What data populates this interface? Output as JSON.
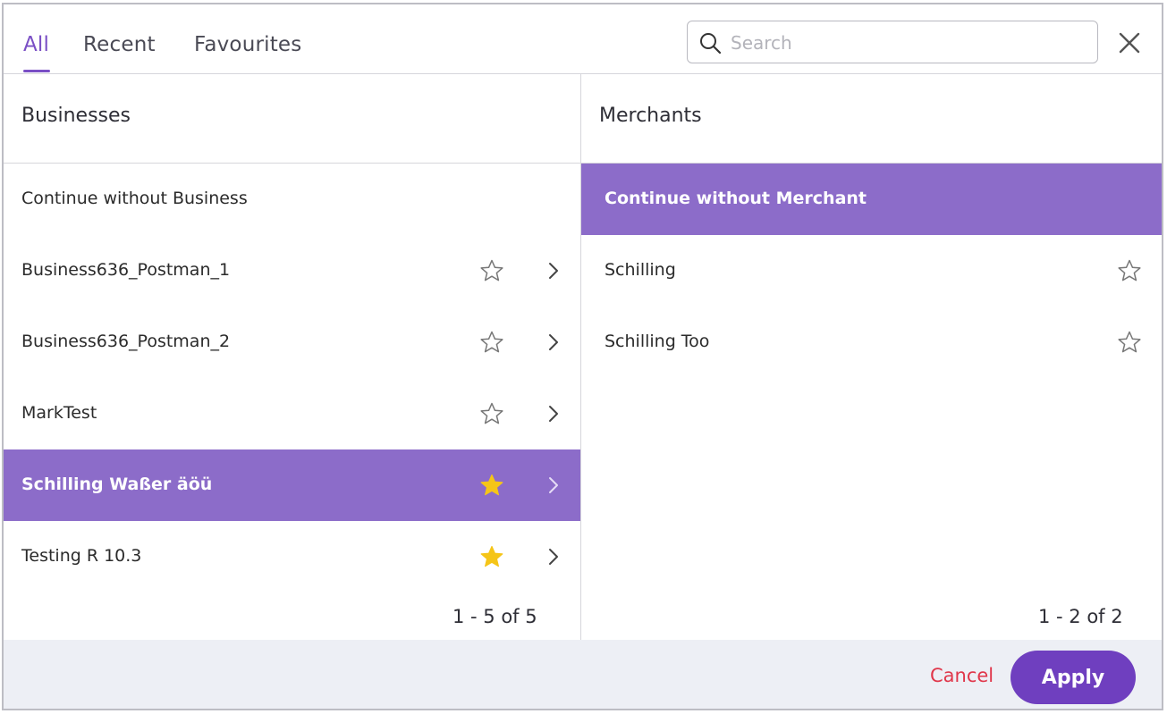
{
  "tabs": [
    {
      "label": "All",
      "active": true
    },
    {
      "label": "Recent",
      "active": false
    },
    {
      "label": "Favourites",
      "active": false
    }
  ],
  "search": {
    "placeholder": "Search",
    "value": ""
  },
  "businesses": {
    "header": "Businesses",
    "items": [
      {
        "label": "Continue without Business",
        "selected": false,
        "favourite": null
      },
      {
        "label": "Business636_Postman_1",
        "selected": false,
        "favourite": false
      },
      {
        "label": "Business636_Postman_2",
        "selected": false,
        "favourite": false
      },
      {
        "label": "MarkTest",
        "selected": false,
        "favourite": false
      },
      {
        "label": "Schilling Waßer äöü",
        "selected": true,
        "favourite": true
      },
      {
        "label": "Testing R 10.3",
        "selected": false,
        "favourite": true
      }
    ],
    "pagination": "1 - 5 of 5"
  },
  "merchants": {
    "header": "Merchants",
    "items": [
      {
        "label": "Continue without Merchant",
        "selected": true,
        "favourite": null
      },
      {
        "label": "Schilling",
        "selected": false,
        "favourite": false
      },
      {
        "label": "Schilling Too",
        "selected": false,
        "favourite": false
      }
    ],
    "pagination": "1 - 2 of 2"
  },
  "footer": {
    "cancel_label": "Cancel",
    "apply_label": "Apply"
  },
  "colors": {
    "accent": "#7a4fc5",
    "selected_row": "#8c6cc9",
    "apply_button": "#6f3fbf",
    "cancel_text": "#e0364a",
    "star_filled": "#f5c518",
    "footer_bg": "#edeff5"
  }
}
